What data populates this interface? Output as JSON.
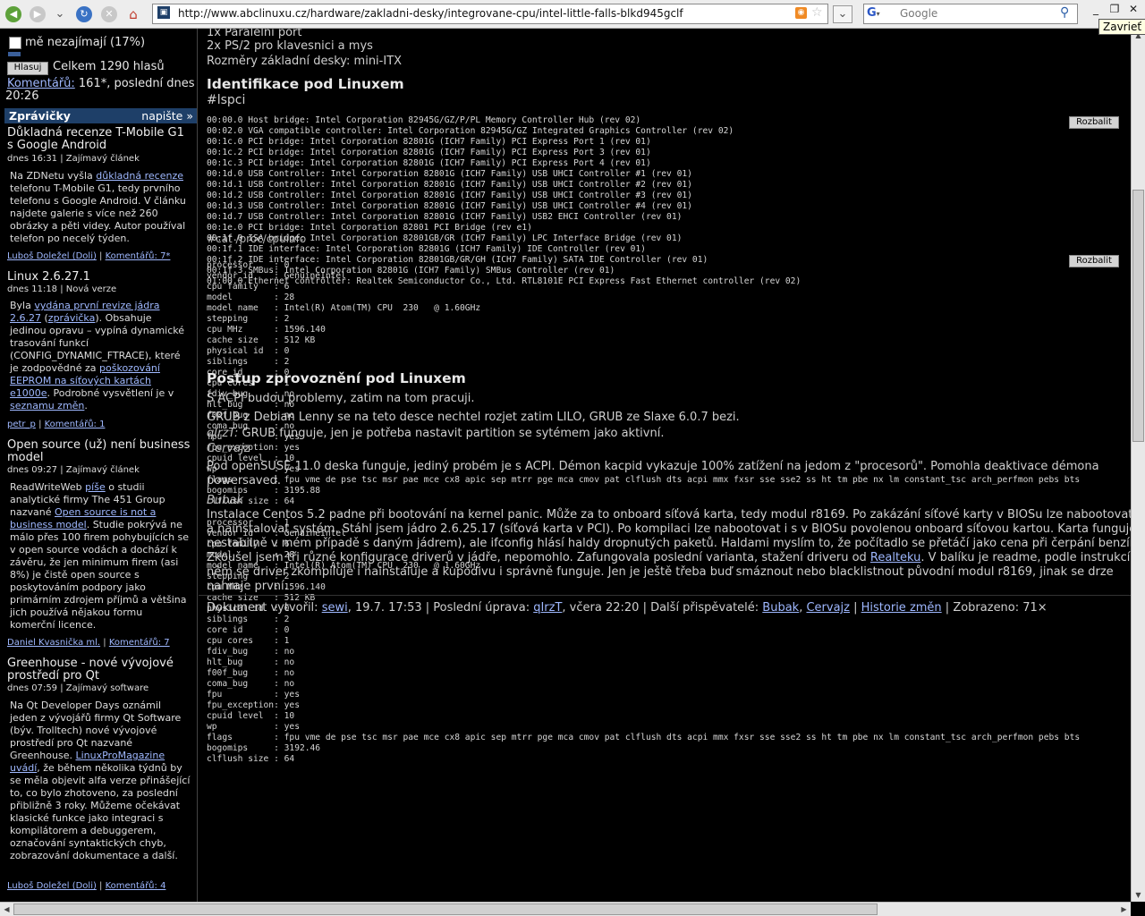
{
  "browser": {
    "url": "http://www.abclinuxu.cz/hardware/zakladni-desky/integrovane-cpu/intel-little-falls-blkd945gclf",
    "search_placeholder": "Google",
    "tooltip": "Zavrieť"
  },
  "sidebar": {
    "poll_option": "mě nezajímají (17%)",
    "vote_button": "Hlasuj",
    "vote_total": "Celkem 1290 hlasů",
    "comments_link": "Komentářů:",
    "comments_info": " 161*, poslední dnes",
    "comments_time": "20:26",
    "news_header": "Zprávičky",
    "news_write": "napište »",
    "news": [
      {
        "title": "Důkladná recenze T-Mobile G1 s Google Android",
        "meta": "dnes 16:31 | Zajímavý článek",
        "body": [
          "Na ZDNetu vyšla ",
          "důkladná recenze",
          " telefonu T-Mobile G1, tedy prvního telefonu s Google Android. V článku najdete galerie s více než 260 obrázky a pěti videy. Autor používal telefon po necelý týden."
        ],
        "author": "Luboš Doležel (Doli)",
        "comments": "Komentářů: 7*"
      },
      {
        "title": "Linux 2.6.27.1",
        "meta": "dnes 11:18 | Nová verze",
        "body": [
          "Byla ",
          "vydána první revize jádra 2.6.27",
          " (",
          "zprávička",
          "). Obsahuje jedinou opravu – vypíná dynamické trasování funkcí (CONFIG_DYNAMIC_FTRACE), které je zodpovědné za ",
          "poškozování EEPROM na síťových kartách e1000e",
          ". Podrobné vysvětlení je v ",
          "seznamu změn",
          "."
        ],
        "author": "petr_p",
        "comments": "Komentářů: 1"
      },
      {
        "title": "Open source (už) není business model",
        "meta": "dnes 09:27 | Zajímavý článek",
        "body": [
          "ReadWriteWeb ",
          "píše",
          " o studii analytické firmy The 451 Group nazvané ",
          "Open source is not a business model",
          ". Studie pokrývá ne málo přes 100 firem pohybujících se v open source vodách a dochází k závěru, že jen minimum firem (asi 8%) je čistě open source s poskytováním podpory jako primárním zdrojem příjmů a většina jich používá nějakou formu komerční licence."
        ],
        "author": "Daniel Kvasnička ml.",
        "comments": "Komentářů: 7"
      },
      {
        "title": "Greenhouse - nové vývojové prostředí pro Qt",
        "meta": "dnes 07:59 | Zajímavý software",
        "body": [
          "Na Qt Developer Days oznámil jeden z vývojářů firmy Qt Software (býv. Trolltech) nové vývojové prostředí pro Qt nazvané Greenhouse. ",
          "LinuxProMagazine uvádí",
          ", že během několika týdnů by se měla objevit alfa verze přinášející to, co bylo zhotoveno, za poslední přibližně 3 roky. Můžeme očekávat klasické funkce jako integraci s kompilátorem a debuggerem, označování syntaktických chyb, zobrazování dokumentace a další."
        ],
        "author": "Luboš Doležel (Doli)",
        "comments": "Komentářů: 4"
      }
    ]
  },
  "main": {
    "intro": [
      "1x Paralelní port",
      "2x PS/2 pro klavesnici a mys",
      "Rozměry základní desky: mini-ITX"
    ],
    "h_ident": "Identifikace pod Linuxem",
    "lspci_tag": "#lspci",
    "expand_label": "Rozbalit",
    "lspci": [
      "00:00.0 Host bridge: Intel Corporation 82945G/GZ/P/PL Memory Controller Hub (rev 02)",
      "00:02.0 VGA compatible controller: Intel Corporation 82945G/GZ Integrated Graphics Controller (rev 02)",
      "00:1c.0 PCI bridge: Intel Corporation 82801G (ICH7 Family) PCI Express Port 1 (rev 01)",
      "00:1c.2 PCI bridge: Intel Corporation 82801G (ICH7 Family) PCI Express Port 3 (rev 01)",
      "00:1c.3 PCI bridge: Intel Corporation 82801G (ICH7 Family) PCI Express Port 4 (rev 01)",
      "00:1d.0 USB Controller: Intel Corporation 82801G (ICH7 Family) USB UHCI Controller #1 (rev 01)",
      "00:1d.1 USB Controller: Intel Corporation 82801G (ICH7 Family) USB UHCI Controller #2 (rev 01)",
      "00:1d.2 USB Controller: Intel Corporation 82801G (ICH7 Family) USB UHCI Controller #3 (rev 01)",
      "00:1d.3 USB Controller: Intel Corporation 82801G (ICH7 Family) USB UHCI Controller #4 (rev 01)",
      "00:1d.7 USB Controller: Intel Corporation 82801G (ICH7 Family) USB2 EHCI Controller (rev 01)",
      "00:1e.0 PCI bridge: Intel Corporation 82801 PCI Bridge (rev e1)",
      "00:1f.0 ISA bridge: Intel Corporation 82801GB/GR (ICH7 Family) LPC Interface Bridge (rev 01)",
      "00:1f.1 IDE interface: Intel Corporation 82801G (ICH7 Family) IDE Controller (rev 01)",
      "00:1f.2 IDE interface: Intel Corporation 82801GB/GR/GH (ICH7 Family) SATA IDE Controller (rev 01)",
      "00:1f.3 SMBus: Intel Corporation 82801G (ICH7 Family) SMBus Controller (rev 01)",
      "01:00.0 Ethernet controller: Realtek Semiconductor Co., Ltd. RTL8101E PCI Express Fast Ethernet controller (rev 02)"
    ],
    "cpuinfo_tag": "#cat /proc/cpuinfo",
    "cpuinfo_overlap": [
      "processor    : 0",
      "vendor_id    : GenuineIntel",
      "cpu family   : 6",
      "model        : 28",
      "model name   : Intel(R) Atom(TM) CPU  230   @ 1.60GHz",
      "stepping     : 2",
      "cpu MHz      : 1596.140",
      "cache size   : 512 KB",
      "physical id  : 0",
      "siblings     : 2",
      "core id      : 0",
      "cpu cores    : 1",
      "fdiv_bug     : no",
      "hlt_bug      : no",
      "f00f_bug     : no",
      "coma_bug     : no",
      "fpu          : yes",
      "fpu_exception: yes",
      "cpuid level  : 10",
      "wp           : yes",
      "flags        : fpu vme de pse tsc msr pae mce cx8 apic sep mtrr pge mca cmov pat clflush dts acpi mmx fxsr sse sse2 ss ht tm pbe nx lm constant_tsc arch_perfmon pebs bts",
      "bogomips     : 3195.88",
      "clflush size : 64",
      "",
      "processor    : 1",
      "vendor_id    : GenuineIntel",
      "cpu family   : 6",
      "model        : 28",
      "model name   : Intel(R) Atom(TM) CPU  230   @ 1.60GHz",
      "stepping     : 2",
      "cpu MHz      : 1596.140",
      "cache size   : 512 KB",
      "physical id  : 0",
      "siblings     : 2",
      "core id      : 0",
      "cpu cores    : 1",
      "fdiv_bug     : no",
      "hlt_bug      : no",
      "f00f_bug     : no",
      "coma_bug     : no",
      "fpu          : yes",
      "fpu_exception: yes",
      "cpuid level  : 10",
      "wp           : yes",
      "flags        : fpu vme de pse tsc msr pae mce cx8 apic sep mtrr pge mca cmov pat clflush dts acpi mmx fxsr sse sse2 ss ht tm pbe nx lm constant_tsc arch_perfmon pebs bts",
      "bogomips     : 3192.46",
      "clflush size : 64"
    ],
    "h_postup": "Postup zprovoznění pod Linuxem",
    "postup_lines": [
      "S ACPI budou problemy, zatim na tom pracuji.",
      "GRUB z Debian Lenny se na teto desce nechtel rozjet zatim LILO, GRUB ze Slaxe 6.0.7 bezi."
    ],
    "qirzt_line": [
      "qIrzT:",
      " GRUB funguje, jen je potřeba nastavit partition se sytémem jako aktivní."
    ],
    "author_cervajz": "Cervajz",
    "cervajz_text": [
      "Pod openSUSE 11.0 deska funguje, jediný probém je s ACPI. Démon kacpid vykazuje 100% zatížení na jedom z \"procesorů\". Pomohla deaktivace démona",
      "powersaved."
    ],
    "author_bubak": "Bubak",
    "bubak_text": [
      "Instalace Centos 5.2 padne při bootování na kernel panic. Může za to onboard síťová karta, tedy modul r8169. Po zakázání síťové karty v BIOSu lze nabootovat",
      "a nainstalovat systém. Stáhl jsem jádro 2.6.25.17 (síťová karta v PCI). Po kompilaci lze nabootovat i s v BIOSu povolenou onboard síťovou kartou. Karta funguje",
      "nestabilně v mém případě s daným jádrem), ale ifconfig hlásí haldy dropnutých paketů. Haldami myslím to, že počítadlo se přetáčí jako cena při čerpání benzínu.",
      "Zkoušel jsem tři různé konfigurace driverů v jádře, nepomohlo. Zafungovala poslední varianta, stažení driveru od Realteku. V balíku je readme, podle instrukcí v",
      "něm se driver zkompiluje i nainstaluje a kupodivu i správně funguje. Jen je ještě třeba buď smáznout nebo blacklistnout původní modul r8169, jinak se drze",
      "nahraje první."
    ],
    "footer": {
      "created": "Dokument vytvořil: ",
      "creator": "sewi",
      "date": ", 19.7. 17:53 | Poslední úprava: ",
      "editor": "qIrzT",
      "edit_date": ", včera 22:20 | Další přispěvatelé: ",
      "contrib1": "Bubak",
      "sep": ", ",
      "contrib2": "Cervajz",
      "bar": " | ",
      "history": "Historie změn",
      "views": " | Zobrazeno: 71×"
    }
  }
}
